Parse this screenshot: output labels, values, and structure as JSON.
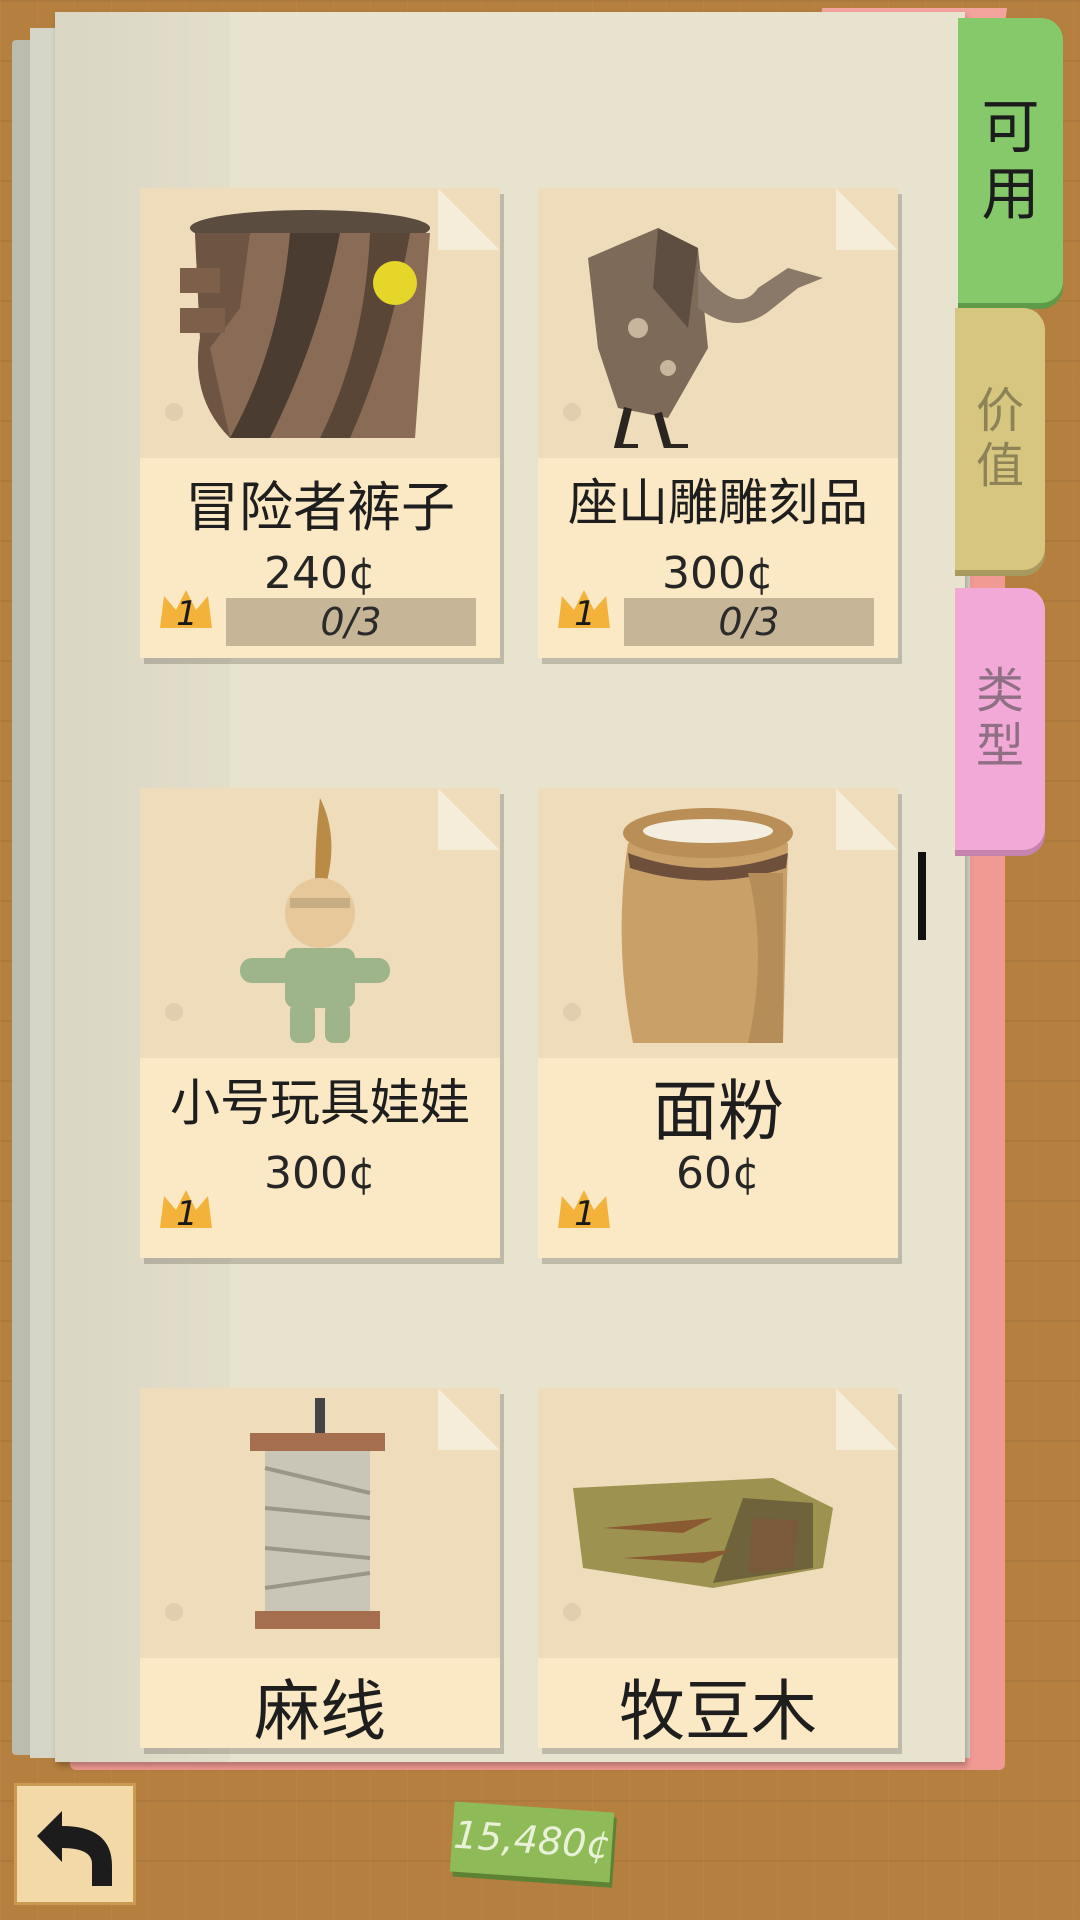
{
  "tabs": [
    {
      "label_line1": "可",
      "label_line2": "用"
    },
    {
      "label_line1": "价",
      "label_line2": "值"
    },
    {
      "label_line1": "类",
      "label_line2": "型"
    }
  ],
  "items": [
    {
      "name": "冒险者裤子",
      "price": "240¢",
      "level": "1",
      "progress": "0/3",
      "icon": "pants-icon"
    },
    {
      "name": "座山雕雕刻品",
      "price": "300¢",
      "level": "1",
      "progress": "0/3",
      "icon": "vulture-carving-icon"
    },
    {
      "name": "小号玩具娃娃",
      "price": "300¢",
      "level": "1",
      "icon": "toy-doll-icon"
    },
    {
      "name": "面粉",
      "price": "60¢",
      "level": "1",
      "icon": "flour-sack-icon"
    },
    {
      "name": "麻线",
      "icon": "twine-spool-icon"
    },
    {
      "name": "牧豆木",
      "icon": "mesquite-wood-icon"
    }
  ],
  "money": "15,480¢",
  "colors": {
    "tab_available": "#86c96a",
    "tab_value": "#d7c680",
    "tab_type": "#f3a9d8",
    "card": "#fbe8c5"
  }
}
